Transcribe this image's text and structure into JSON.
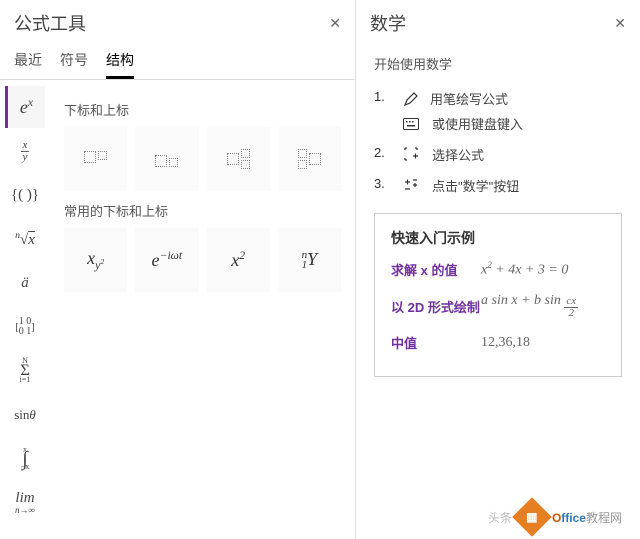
{
  "left": {
    "title": "公式工具",
    "tabs": {
      "recent": "最近",
      "symbols": "符号",
      "structures": "结构"
    },
    "rail": [
      "eˣ",
      "x/y",
      "{()}",
      "ⁿ√x",
      "ä",
      "[1 0; 0 1]",
      "Σ",
      "sin θ",
      "∫",
      "lim"
    ],
    "section1": "下标和上标",
    "section2": "常用的下标和上标",
    "examples": {
      "a": "x_{y²}",
      "b": "e^{−iωt}",
      "c": "x²",
      "d": "ⁿ₁Y"
    }
  },
  "right": {
    "title": "数学",
    "heading": "开始使用数学",
    "steps": {
      "s1": "1.",
      "s1a": "用笔绘写公式",
      "s1b": "或使用键盘键入",
      "s2": "2.",
      "s2a": "选择公式",
      "s3": "3.",
      "s3a": "点击\"数学\"按钮"
    },
    "example": {
      "title": "快速入门示例",
      "r1_label": "求解 x 的值",
      "r1_math": "x² + 4x + 3 = 0",
      "r2_label": "以 2D 形式绘制",
      "r2_math": "a sin x + b sin (cx/2)",
      "r3_label": "中值",
      "r3_math": "12,36,18"
    }
  },
  "watermark": {
    "brand": "Office",
    "suffix": "教程网",
    "sub": "头条"
  }
}
